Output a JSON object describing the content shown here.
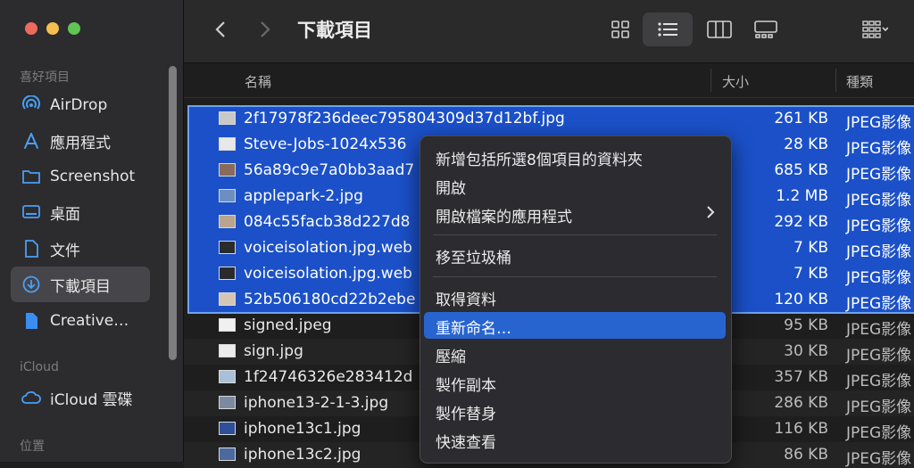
{
  "window": {
    "title": "下載項目"
  },
  "sidebar": {
    "favorites_header": "喜好項目",
    "items": [
      {
        "label": "AirDrop",
        "icon": "airdrop-icon"
      },
      {
        "label": "應用程式",
        "icon": "applications-icon"
      },
      {
        "label": "Screenshot",
        "icon": "folder-icon"
      },
      {
        "label": "桌面",
        "icon": "desktop-icon"
      },
      {
        "label": "文件",
        "icon": "document-icon"
      },
      {
        "label": "下載項目",
        "icon": "downloads-icon",
        "active": true
      },
      {
        "label": "Creative…",
        "icon": "file-icon"
      }
    ],
    "icloud_header": "iCloud",
    "icloud_items": [
      {
        "label": "iCloud 雲碟",
        "icon": "icloud-icon"
      }
    ],
    "locations_header": "位置"
  },
  "columns": {
    "name": "名稱",
    "size": "大小",
    "kind": "種類"
  },
  "files": [
    {
      "name": "2f17978f236deec795804309d37d12bf.jpg",
      "size": "261 KB",
      "kind": "JPEG影像",
      "selected": true
    },
    {
      "name": "Steve-Jobs-1024x536",
      "size": "28 KB",
      "kind": "JPEG影像",
      "selected": true
    },
    {
      "name": "56a89c9e7a0bb3aad7",
      "size": "685 KB",
      "kind": "JPEG影像",
      "selected": true
    },
    {
      "name": "applepark-2.jpg",
      "size": "1.2 MB",
      "kind": "JPEG影像",
      "selected": true
    },
    {
      "name": "084c55facb38d227d8",
      "size": "292 KB",
      "kind": "JPEG影像",
      "selected": true
    },
    {
      "name": "voiceisolation.jpg.web",
      "size": "7 KB",
      "kind": "JPEG影像",
      "selected": true
    },
    {
      "name": "voiceisolation.jpg.web",
      "size": "7 KB",
      "kind": "JPEG影像",
      "selected": true
    },
    {
      "name": "52b506180cd22b2ebe",
      "size": "120 KB",
      "kind": "JPEG影像",
      "selected": true
    },
    {
      "name": "signed.jpeg",
      "size": "95 KB",
      "kind": "JPEG影像",
      "selected": false
    },
    {
      "name": "sign.jpg",
      "size": "30 KB",
      "kind": "JPEG影像",
      "selected": false
    },
    {
      "name": "1f24746326e283412d",
      "size": "357 KB",
      "kind": "JPEG影像",
      "selected": false
    },
    {
      "name": "iphone13-2-1-3.jpg",
      "size": "286 KB",
      "kind": "JPEG影像",
      "selected": false
    },
    {
      "name": "iphone13c1.jpg",
      "size": "116 KB",
      "kind": "JPEG影像",
      "selected": false
    },
    {
      "name": "iphone13c2.jpg",
      "size": "86 KB",
      "kind": "JPEG影像",
      "selected": false
    }
  ],
  "context_menu": {
    "items": [
      {
        "label": "新增包括所選8個項目的資料夾"
      },
      {
        "label": "開啟"
      },
      {
        "label": "開啟檔案的應用程式",
        "submenu": true
      },
      {
        "separator": true
      },
      {
        "label": "移至垃圾桶"
      },
      {
        "separator": true
      },
      {
        "label": "取得資料"
      },
      {
        "label": "重新命名…",
        "highlighted": true
      },
      {
        "label": "壓縮"
      },
      {
        "label": "製作副本"
      },
      {
        "label": "製作替身"
      },
      {
        "label": "快速查看"
      }
    ]
  },
  "colors": {
    "selection": "#1b50c8",
    "menu_highlight": "#2864d0",
    "accent": "#6fa3f2"
  }
}
